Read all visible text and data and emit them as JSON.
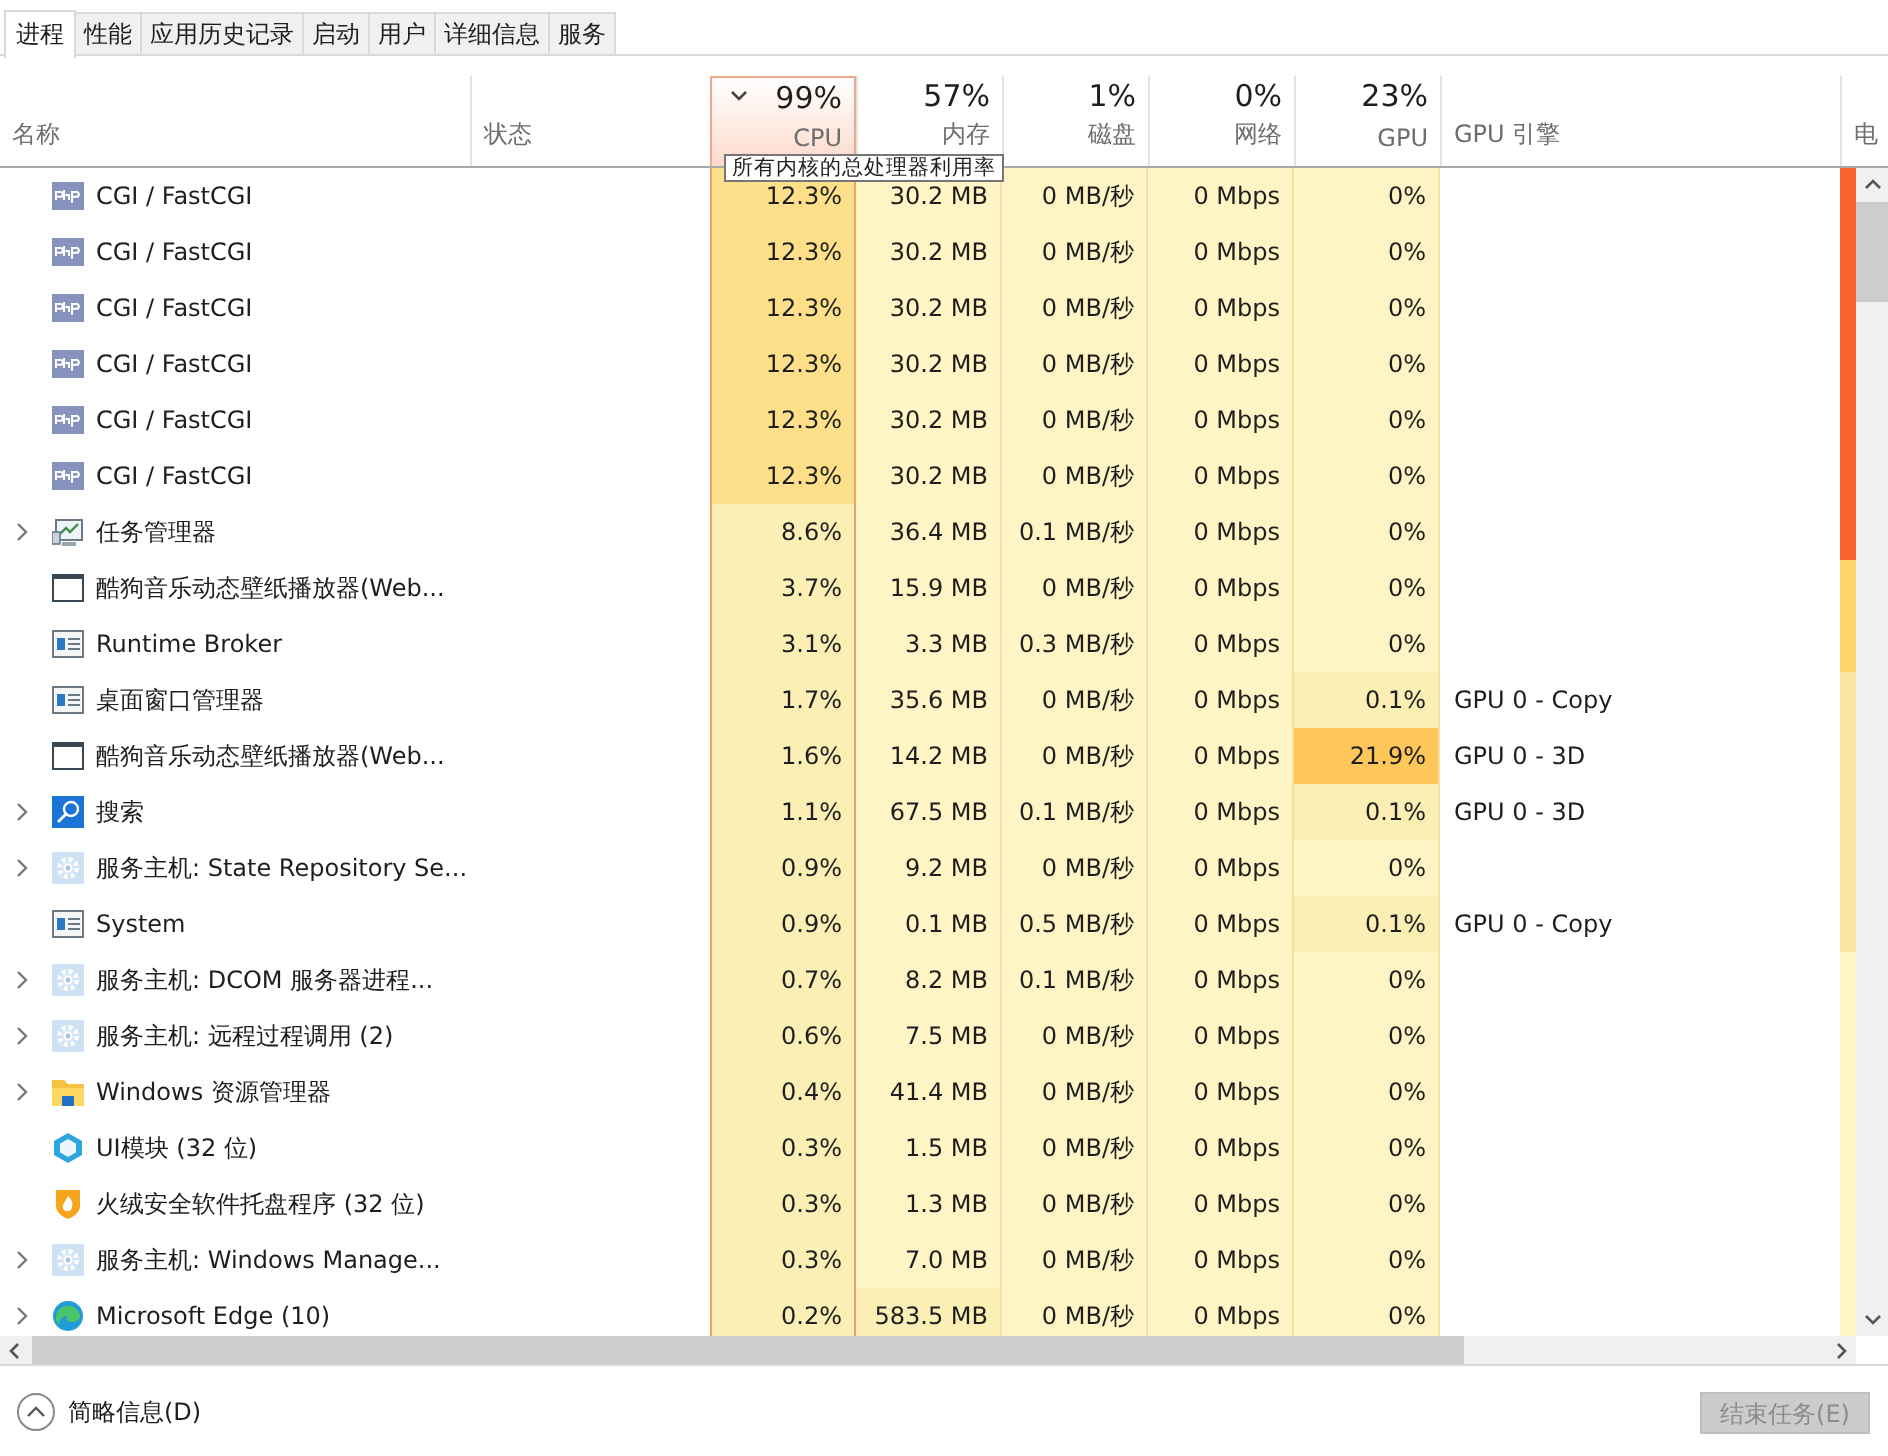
{
  "tabs": [
    {
      "label": "进程",
      "selected": true
    },
    {
      "label": "性能",
      "selected": false
    },
    {
      "label": "应用历史记录",
      "selected": false
    },
    {
      "label": "启动",
      "selected": false
    },
    {
      "label": "用户",
      "selected": false
    },
    {
      "label": "详细信息",
      "selected": false
    },
    {
      "label": "服务",
      "selected": false
    }
  ],
  "columns": [
    {
      "label": "名称",
      "sorted": false
    },
    {
      "label": "状态",
      "sorted": false
    },
    {
      "percent": "99%",
      "label": "CPU",
      "sorted": true
    },
    {
      "percent": "57%",
      "label": "内存",
      "sorted": false
    },
    {
      "percent": "1%",
      "label": "磁盘",
      "sorted": false
    },
    {
      "percent": "0%",
      "label": "网络",
      "sorted": false
    },
    {
      "percent": "23%",
      "label": "GPU",
      "sorted": false
    },
    {
      "label": "GPU 引擎",
      "sorted": false
    },
    {
      "label": "电",
      "sorted": false
    }
  ],
  "tooltip": "所有内核的总处理器利用率",
  "rows": [
    {
      "kind": "php",
      "name": "CGI / FastCGI",
      "expandable": false,
      "cpu": "12.3%",
      "memory": "30.2 MB",
      "disk": "0 MB/秒",
      "network": "0 Mbps",
      "gpu": "0%",
      "color": "#f7632a"
    },
    {
      "kind": "php",
      "name": "CGI / FastCGI",
      "expandable": false,
      "cpu": "12.3%",
      "memory": "30.2 MB",
      "disk": "0 MB/秒",
      "network": "0 Mbps",
      "gpu": "0%",
      "color": "#f7632a"
    },
    {
      "kind": "php",
      "name": "CGI / FastCGI",
      "expandable": false,
      "cpu": "12.3%",
      "memory": "30.2 MB",
      "disk": "0 MB/秒",
      "network": "0 Mbps",
      "gpu": "0%",
      "color": "#f7632a"
    },
    {
      "kind": "php",
      "name": "CGI / FastCGI",
      "expandable": false,
      "cpu": "12.3%",
      "memory": "30.2 MB",
      "disk": "0 MB/秒",
      "network": "0 Mbps",
      "gpu": "0%",
      "color": "#f7632a"
    },
    {
      "kind": "php",
      "name": "CGI / FastCGI",
      "expandable": false,
      "cpu": "12.3%",
      "memory": "30.2 MB",
      "disk": "0 MB/秒",
      "network": "0 Mbps",
      "gpu": "0%",
      "color": "#f7632a"
    },
    {
      "kind": "php",
      "name": "CGI / FastCGI",
      "expandable": false,
      "cpu": "12.3%",
      "memory": "30.2 MB",
      "disk": "0 MB/秒",
      "network": "0 Mbps",
      "gpu": "0%",
      "color": "#f7632a"
    },
    {
      "kind": "monitor",
      "name": "任务管理器",
      "expandable": true,
      "cpu": "8.6%",
      "memory": "36.4 MB",
      "disk": "0.1 MB/秒",
      "network": "0 Mbps",
      "gpu": "0%",
      "color": "#f7632a"
    },
    {
      "kind": "window",
      "name": "酷狗音乐动态壁纸播放器(Web...",
      "expandable": false,
      "cpu": "3.7%",
      "memory": "15.9 MB",
      "disk": "0 MB/秒",
      "network": "0 Mbps",
      "gpu": "0%",
      "color": "#ffd66b"
    },
    {
      "kind": "app",
      "name": "Runtime Broker",
      "expandable": false,
      "cpu": "3.1%",
      "memory": "3.3 MB",
      "disk": "0.3 MB/秒",
      "network": "0 Mbps",
      "gpu": "0%",
      "color": "#ffd66b"
    },
    {
      "kind": "app",
      "name": "桌面窗口管理器",
      "expandable": false,
      "cpu": "1.7%",
      "memory": "35.6 MB",
      "disk": "0 MB/秒",
      "network": "0 Mbps",
      "gpu": "0.1%",
      "gpu_engine": "GPU 0 - Copy",
      "color": "#fbe7a5"
    },
    {
      "kind": "window",
      "name": "酷狗音乐动态壁纸播放器(Web...",
      "expandable": false,
      "cpu": "1.6%",
      "memory": "14.2 MB",
      "disk": "0 MB/秒",
      "network": "0 Mbps",
      "gpu": "21.9%",
      "gpu_engine": "GPU 0 - 3D",
      "color": "#fbe7a5"
    },
    {
      "kind": "search",
      "name": "搜索",
      "expandable": true,
      "cpu": "1.1%",
      "memory": "67.5 MB",
      "disk": "0.1 MB/秒",
      "network": "0 Mbps",
      "gpu": "0.1%",
      "gpu_engine": "GPU 0 - 3D",
      "color": "#fbe7a5"
    },
    {
      "kind": "gear",
      "name": "服务主机: State Repository Se...",
      "expandable": true,
      "cpu": "0.9%",
      "memory": "9.2 MB",
      "disk": "0 MB/秒",
      "network": "0 Mbps",
      "gpu": "0%",
      "color": "#fbe7a5"
    },
    {
      "kind": "app",
      "name": "System",
      "expandable": false,
      "cpu": "0.9%",
      "memory": "0.1 MB",
      "disk": "0.5 MB/秒",
      "network": "0 Mbps",
      "gpu": "0.1%",
      "gpu_engine": "GPU 0 - Copy",
      "color": "#fbe7a5"
    },
    {
      "kind": "gear",
      "name": "服务主机: DCOM 服务器进程...",
      "expandable": true,
      "cpu": "0.7%",
      "memory": "8.2 MB",
      "disk": "0.1 MB/秒",
      "network": "0 Mbps",
      "gpu": "0%",
      "color": "#fff4c4"
    },
    {
      "kind": "gear",
      "name": "服务主机: 远程过程调用 (2)",
      "expandable": true,
      "cpu": "0.6%",
      "memory": "7.5 MB",
      "disk": "0 MB/秒",
      "network": "0 Mbps",
      "gpu": "0%",
      "color": "#fff4c4"
    },
    {
      "kind": "folder",
      "name": "Windows 资源管理器",
      "expandable": true,
      "cpu": "0.4%",
      "memory": "41.4 MB",
      "disk": "0 MB/秒",
      "network": "0 Mbps",
      "gpu": "0%",
      "color": "#fff4c4"
    },
    {
      "kind": "hexagon",
      "name": "UI模块 (32 位)",
      "expandable": false,
      "cpu": "0.3%",
      "memory": "1.5 MB",
      "disk": "0 MB/秒",
      "network": "0 Mbps",
      "gpu": "0%",
      "color": "#fff4c4"
    },
    {
      "kind": "flame",
      "name": "火绒安全软件托盘程序 (32 位)",
      "expandable": false,
      "cpu": "0.3%",
      "memory": "1.3 MB",
      "disk": "0 MB/秒",
      "network": "0 Mbps",
      "gpu": "0%",
      "color": "#fff4c4"
    },
    {
      "kind": "gear",
      "name": "服务主机: Windows Manage...",
      "expandable": true,
      "cpu": "0.3%",
      "memory": "7.0 MB",
      "disk": "0 MB/秒",
      "network": "0 Mbps",
      "gpu": "0%",
      "color": "#fff4c4"
    },
    {
      "kind": "edge",
      "name": "Microsoft Edge (10)",
      "expandable": true,
      "cpu": "0.2%",
      "memory": "583.5 MB",
      "disk": "0 MB/秒",
      "network": "0 Mbps",
      "gpu": "0%",
      "color": "#fff4c4"
    }
  ],
  "fewer_details": "简略信息(D)",
  "end_task": {
    "label": "结束任务(E)",
    "disabled": true
  }
}
